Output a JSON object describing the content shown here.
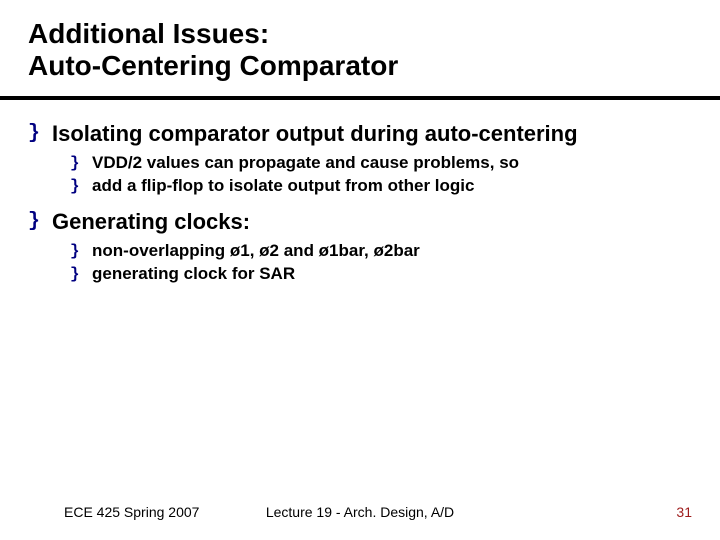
{
  "title": {
    "line1": "Additional Issues:",
    "line2": "Auto-Centering Comparator"
  },
  "bullets": [
    {
      "text": "Isolating comparator output during auto-centering",
      "sub": [
        "VDD/2 values can propagate and cause problems, so",
        "add a flip-flop to isolate output from other logic"
      ]
    },
    {
      "text": "Generating clocks:",
      "sub": [
        "non-overlapping ø1, ø2 and ø1bar, ø2bar",
        "generating clock for SAR"
      ]
    }
  ],
  "bullet_glyph": "}",
  "footer": {
    "left": "ECE 425 Spring 2007",
    "center": "Lecture 19 - Arch. Design, A/D",
    "page": "31"
  }
}
